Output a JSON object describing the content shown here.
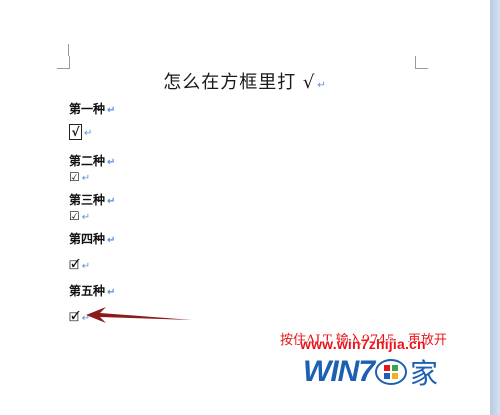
{
  "document": {
    "title": "怎么在方框里打 √",
    "paragraph_mark": "↵",
    "sections": [
      {
        "label": "第一种",
        "symbol": "√"
      },
      {
        "label": "第二种",
        "symbol": "☑"
      },
      {
        "label": "第三种",
        "symbol": "☑"
      },
      {
        "label": "第四种",
        "symbol": "🗹"
      },
      {
        "label": "第五种",
        "symbol": "🗹"
      }
    ]
  },
  "annotation": {
    "note": "按住ALT 输入9745，再放开",
    "arrow_color": "#8b1a1a"
  },
  "watermark": {
    "url": "www.win7zhijia.cn",
    "logo_text": "WIN7",
    "logo_suffix": "家"
  },
  "colors": {
    "page": "#ffffff",
    "workspace": "#cbdaed",
    "note_red": "#e8141a",
    "logo_blue": "#1d5fb3"
  }
}
